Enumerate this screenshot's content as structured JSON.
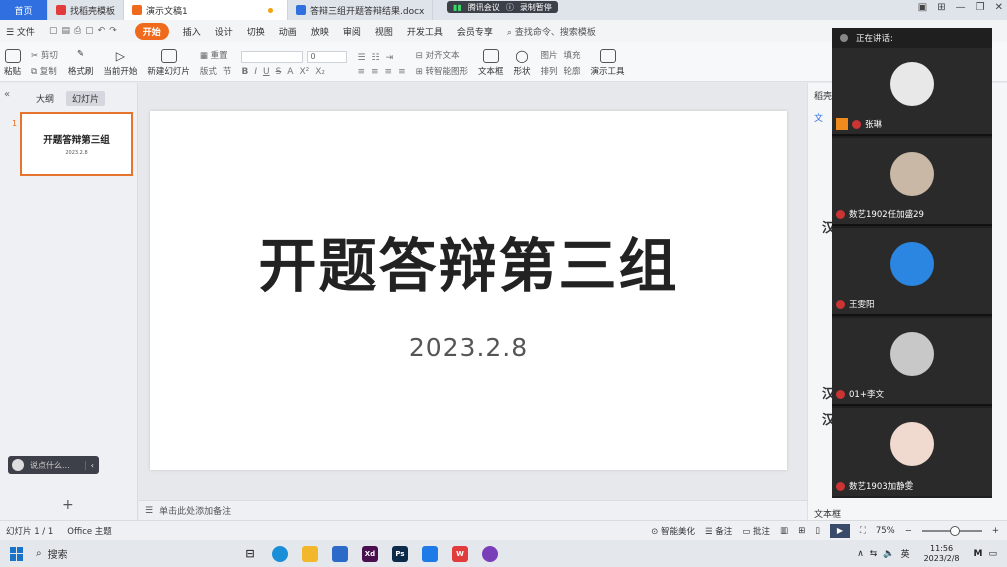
{
  "tabs": {
    "home": "首页",
    "template": "找稻壳模板",
    "presentation": "演示文稿1",
    "doc": "答辩三组开题答辩结果.docx"
  },
  "meeting_pill": {
    "label": "腾讯会议",
    "recording": "录制暂停"
  },
  "menu": {
    "file": "☰ 文件",
    "start": "开始",
    "items": [
      "插入",
      "设计",
      "切换",
      "动画",
      "放映",
      "审阅",
      "视图",
      "开发工具",
      "会员专享"
    ],
    "search": "查找命令、搜索模板"
  },
  "ribbon": {
    "paste": "粘贴",
    "cut": "剪切",
    "copy": "复制",
    "format_painter": "格式刷",
    "play_from_current": "当前开始",
    "new_slide": "新建幻灯片",
    "layout": "版式",
    "section": "节",
    "reset": "重置",
    "font_size": "0",
    "text_box": "文本框",
    "shape": "形状",
    "arrange": "排列",
    "picture": "图片",
    "fill": "填充",
    "outline": "轮廓",
    "presentation_tools": "演示工具",
    "align_text": "对齐文本",
    "convert_smartart": "转智能图形"
  },
  "left_panel": {
    "tab_outline": "大纲",
    "tab_slides": "幻灯片",
    "slide_index": "1",
    "thumb_title": "开题答辩第三组",
    "thumb_date": "2023.2.8",
    "comment_placeholder": "说点什么..."
  },
  "slide": {
    "title": "开题答辩第三组",
    "date": "2023.2.8"
  },
  "notes_placeholder": "单击此处添加备注",
  "right_panel": {
    "header": "稻壳资",
    "tab": "文",
    "textbox_label": "文本框"
  },
  "meeting": {
    "speaking_label": "正在讲话:",
    "participants": [
      {
        "name": "张琳",
        "avatar_color": "#e8e8e8"
      },
      {
        "name": "数艺1902任加盛29",
        "avatar_color": "#c9b8a5"
      },
      {
        "name": "王雯阳",
        "avatar_color": "#2a86e0"
      },
      {
        "name": "01+李文",
        "avatar_color": "#c8c8c8"
      },
      {
        "name": "数艺1903加静雯",
        "avatar_color": "#f0d9cf"
      }
    ]
  },
  "status": {
    "slide_count": "幻灯片 1 / 1",
    "theme": "Office 主题",
    "smart_beautify": "智能美化",
    "notes": "备注",
    "comments": "批注",
    "zoom": "75%"
  },
  "taskbar": {
    "search": "搜索",
    "ime": "英",
    "time": "11:56",
    "date": "2023/2/8"
  },
  "colors": {
    "accent": "#f06a1d",
    "home_tab": "#2f6fe0",
    "meeting_bg": "#1f1f1f"
  }
}
